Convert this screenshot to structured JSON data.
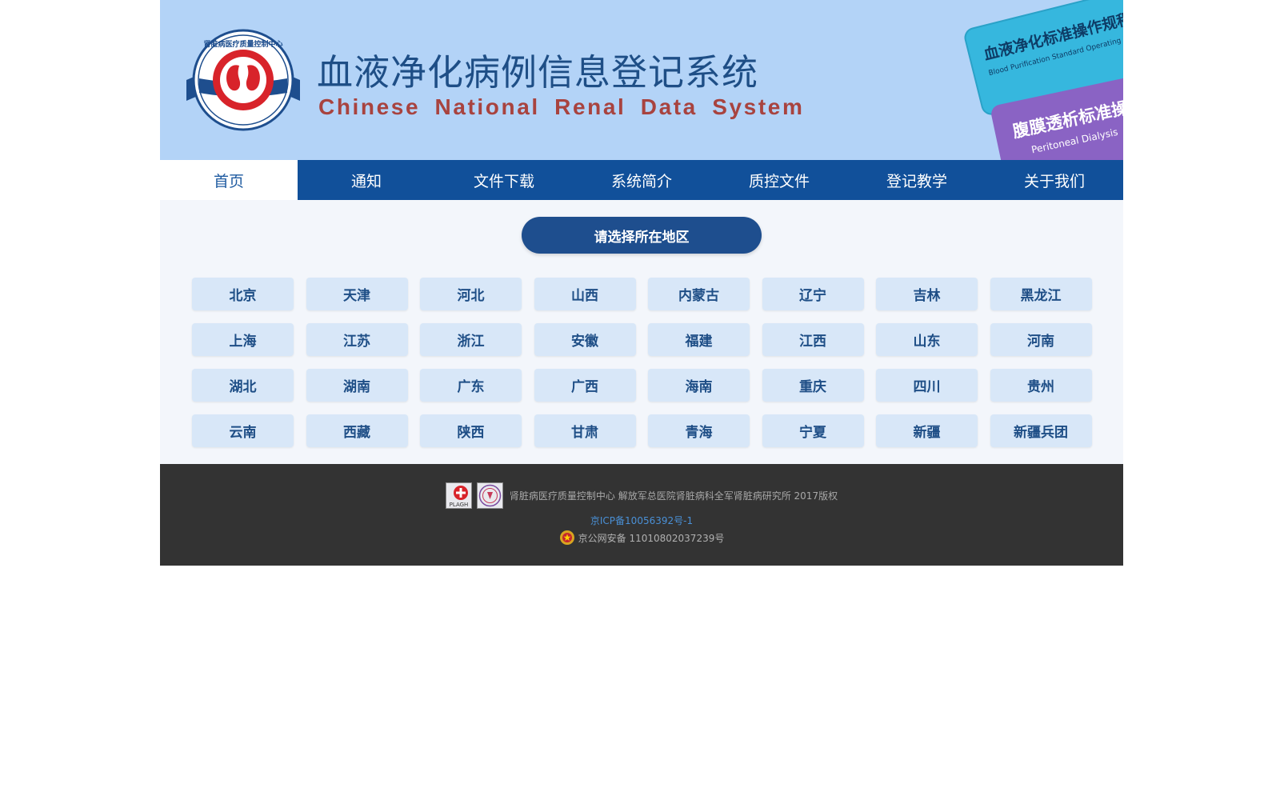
{
  "header": {
    "title_cn": "血液净化病例信息登记系统",
    "title_en": "Chinese National Renal Data System",
    "logo_text": "肾脏病医疗质量控制中心",
    "book1_title": "血液净化标准操作规程",
    "book1_subtitle": "Blood Purification Standard Operating Procedure (SOP)",
    "book2_title": "腹膜透析标准操作规程",
    "book2_subtitle": "Peritoneal Dialysis"
  },
  "nav": {
    "items": [
      {
        "label": "首页"
      },
      {
        "label": "通知"
      },
      {
        "label": "文件下载"
      },
      {
        "label": "系统简介"
      },
      {
        "label": "质控文件"
      },
      {
        "label": "登记教学"
      },
      {
        "label": "关于我们"
      }
    ],
    "active": "首页"
  },
  "region": {
    "button_label": "请选择所在地区",
    "provinces": [
      "北京",
      "天津",
      "河北",
      "山西",
      "内蒙古",
      "辽宁",
      "吉林",
      "黑龙江",
      "上海",
      "江苏",
      "浙江",
      "安徽",
      "福建",
      "江西",
      "山东",
      "河南",
      "湖北",
      "湖南",
      "广东",
      "广西",
      "海南",
      "重庆",
      "四川",
      "贵州",
      "云南",
      "西藏",
      "陕西",
      "甘肃",
      "青海",
      "宁夏",
      "新疆",
      "新疆兵团"
    ]
  },
  "footer": {
    "copyright": "肾脏病医疗质量控制中心 解放军总医院肾脏病科全军肾脏病研究所 2017版权",
    "icp": "京ICP备10056392号-1",
    "police": "京公网安备 11010802037239号",
    "logo1_text": "PLAGH"
  },
  "colors": {
    "header_bg": "#b3d3f7",
    "nav_bg": "#11509a",
    "primary": "#1e4e86",
    "title_en": "#a8433f",
    "province_bg": "#d8e7f8",
    "footer_bg": "#333333"
  }
}
